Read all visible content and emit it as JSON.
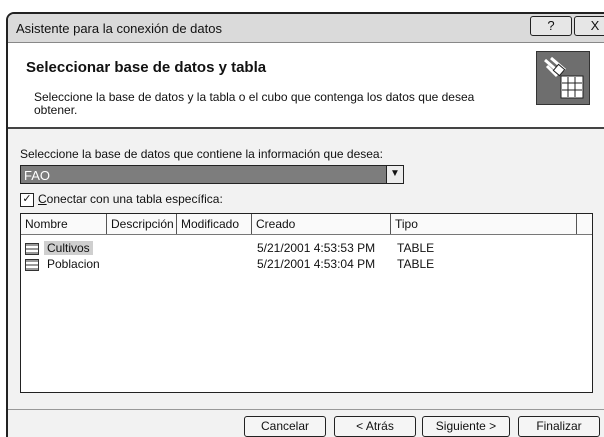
{
  "window": {
    "title": "Asistente para la conexión de datos",
    "help_label": "?",
    "close_label": "X"
  },
  "header": {
    "title": "Seleccionar base de datos y tabla",
    "description": "Seleccione la base de datos y la tabla o el cubo que contenga los datos que desea obtener."
  },
  "database": {
    "label": "Seleccione la base de datos que contiene la información que desea:",
    "selected": "FAO"
  },
  "connect_specific": {
    "checked": true,
    "label_accel": "C",
    "label_rest": "onectar con una tabla específica:"
  },
  "table": {
    "columns": [
      "Nombre",
      "Descripción",
      "Modificado",
      "Creado",
      "Tipo"
    ],
    "rows": [
      {
        "nombre": "Cultivos",
        "descripcion": "",
        "modificado": "",
        "creado": "5/21/2001 4:53:53 PM",
        "tipo": "TABLE",
        "selected": true
      },
      {
        "nombre": "Poblacion",
        "descripcion": "",
        "modificado": "",
        "creado": "5/21/2001 4:53:04 PM",
        "tipo": "TABLE",
        "selected": false
      }
    ]
  },
  "buttons": {
    "cancel": "Cancelar",
    "back": "< Atrás",
    "next": "Siguiente >",
    "finish": "Finalizar"
  }
}
